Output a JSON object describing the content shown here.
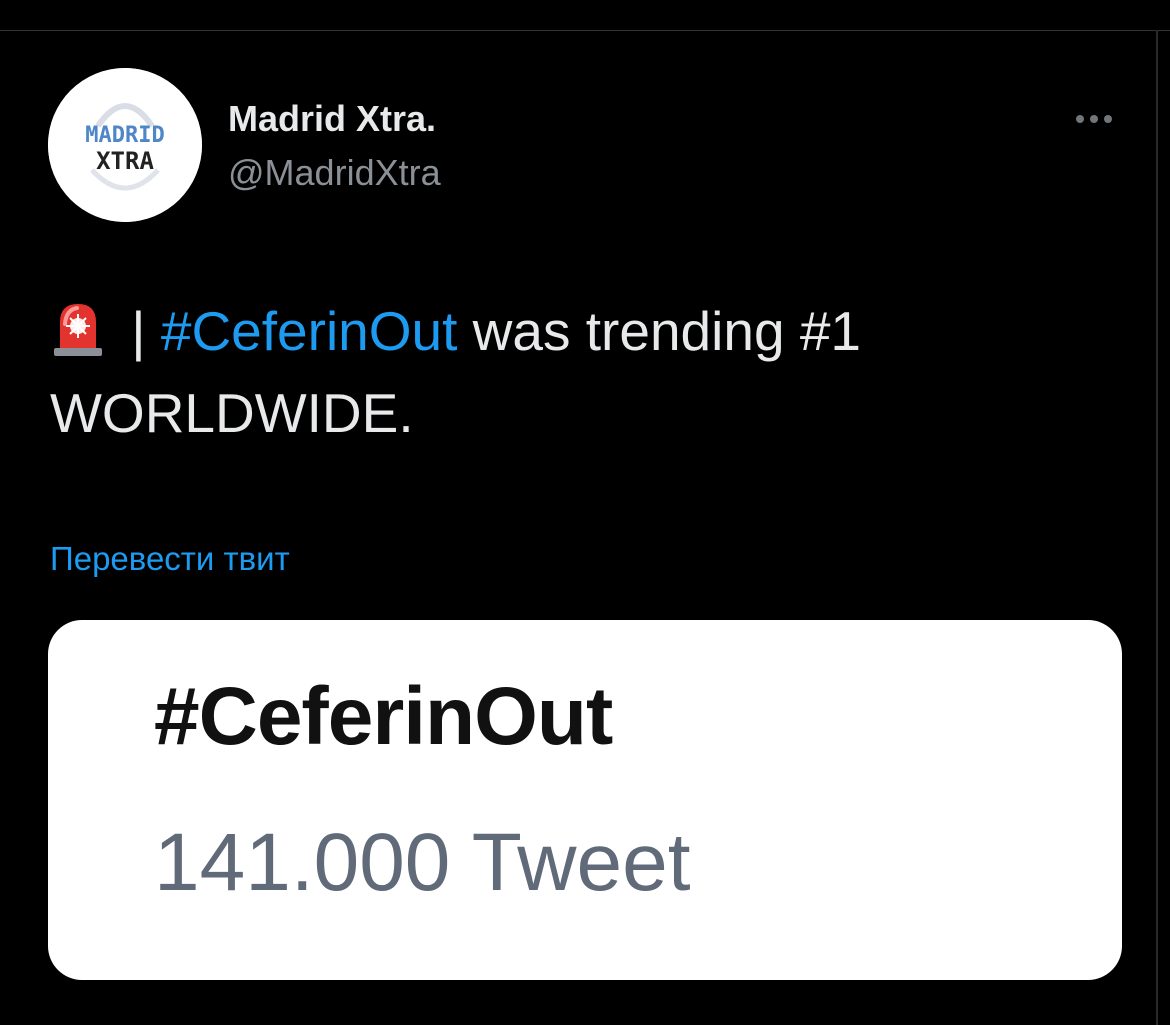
{
  "tweet": {
    "author": {
      "display_name": "Madrid Xtra.",
      "handle": "@MadridXtra",
      "avatar_text_top": "MADRID",
      "avatar_text_bottom": "XTRA",
      "avatar_icon": "madrid-xtra-logo"
    },
    "text": {
      "emoji": "🚨",
      "emoji_icon": "police-siren-icon",
      "separator": " | ",
      "hashtag": "#CeferinOut",
      "rest": " was trending #1 WORLDWIDE."
    },
    "translate_label": "Перевести твит",
    "more_icon": "more-horizontal-icon",
    "media": {
      "hashtag": "#CeferinOut",
      "count": "141.000 Tweet"
    }
  },
  "colors": {
    "background": "#000000",
    "link": "#1d9bf0",
    "text": "#e7e9ea",
    "secondary": "#8b9096",
    "card_background": "#ffffff",
    "card_count": "#606a78"
  }
}
